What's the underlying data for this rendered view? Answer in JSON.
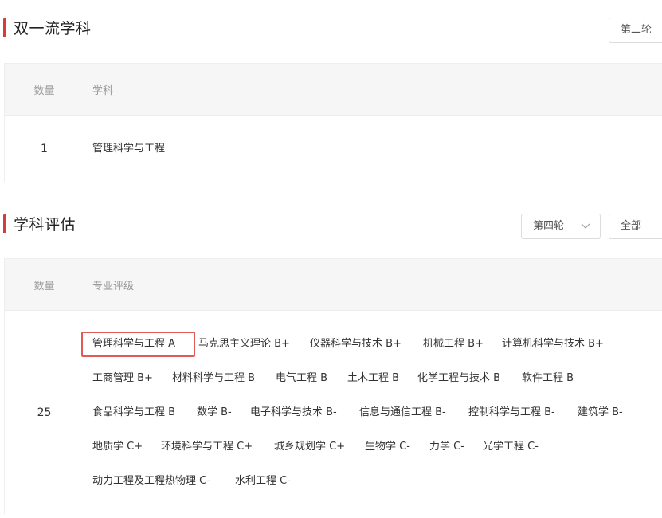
{
  "section1": {
    "title": "双一流学科",
    "round_button": "第二轮",
    "table": {
      "col_count": "数量",
      "col_subject": "学科",
      "count": "1",
      "subject": "管理科学与工程"
    }
  },
  "section2": {
    "title": "学科评估",
    "round_select": "第四轮",
    "scope_select": "全部",
    "table": {
      "col_count": "数量",
      "col_grade": "专业评级",
      "count": "25",
      "rows": [
        [
          "管理科学与工程 A",
          "马克思主义理论 B+",
          "仪器科学与技术 B+",
          "机械工程 B+",
          "计算机科学与技术 B+"
        ],
        [
          "工商管理 B+",
          "材料科学与工程 B",
          "电气工程 B",
          "土木工程 B",
          "化学工程与技术 B",
          "软件工程 B"
        ],
        [
          "食品科学与工程 B",
          "数学 B-",
          "电子科学与技术 B-",
          "信息与通信工程 B-",
          "控制科学与工程 B-",
          "建筑学 B-"
        ],
        [
          "地质学 C+",
          "环境科学与工程 C+",
          "城乡规划学 C+",
          "生物学 C-",
          "力学 C-",
          "光学工程 C-"
        ],
        [
          "动力工程及工程热物理 C-",
          "水利工程 C-"
        ]
      ]
    }
  },
  "colors": {
    "accent": "#d83b3b",
    "highlight_box": "#e05a5a"
  }
}
